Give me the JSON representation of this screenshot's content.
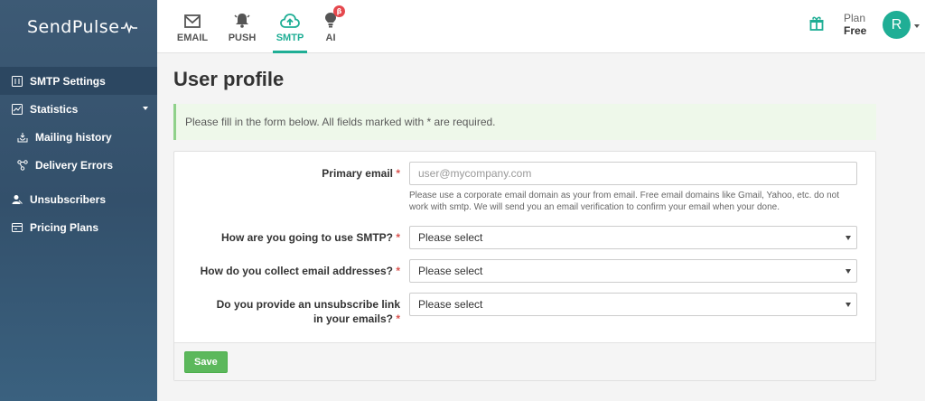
{
  "brand": {
    "name": "SendPulse"
  },
  "colors": {
    "accent": "#1fae95",
    "sidebar": "#3d5a75",
    "required": "#d9534f",
    "save": "#5cb85c"
  },
  "topnav": {
    "tabs": [
      {
        "label": "EMAIL",
        "icon": "envelope-icon"
      },
      {
        "label": "PUSH",
        "icon": "bell-icon"
      },
      {
        "label": "SMTP",
        "icon": "cloud-upload-icon",
        "active": true
      },
      {
        "label": "AI",
        "icon": "ai-bulb-icon",
        "badge": "β"
      }
    ],
    "plan_label": "Plan",
    "plan_value": "Free",
    "avatar_initial": "R"
  },
  "sidebar": {
    "items": [
      {
        "label": "SMTP Settings",
        "icon": "sliders-icon"
      },
      {
        "label": "Statistics",
        "icon": "chart-icon"
      },
      {
        "label": "Mailing history",
        "icon": "inbox-icon"
      },
      {
        "label": "Delivery Errors",
        "icon": "network-icon"
      },
      {
        "label": "Unsubscribers",
        "icon": "user-remove-icon"
      },
      {
        "label": "Pricing Plans",
        "icon": "pricing-icon"
      }
    ]
  },
  "main": {
    "title": "User profile",
    "notice": "Please fill in the form below. All fields marked with * are required.",
    "form": {
      "email_label": "Primary email",
      "email_placeholder": "user@mycompany.com",
      "email_help": "Please use a corporate email domain as your from email. Free email domains like Gmail, Yahoo, etc. do not work with smtp. We will send you an email verification to confirm your email when your done.",
      "usage_label": "How are you going to use SMTP?",
      "usage_value": "Please select",
      "collect_label": "How do you collect email addresses?",
      "collect_value": "Please select",
      "unsub_label": "Do you provide an unsubscribe link in your emails?",
      "unsub_value": "Please select",
      "required_mark": "*",
      "save_label": "Save"
    }
  }
}
